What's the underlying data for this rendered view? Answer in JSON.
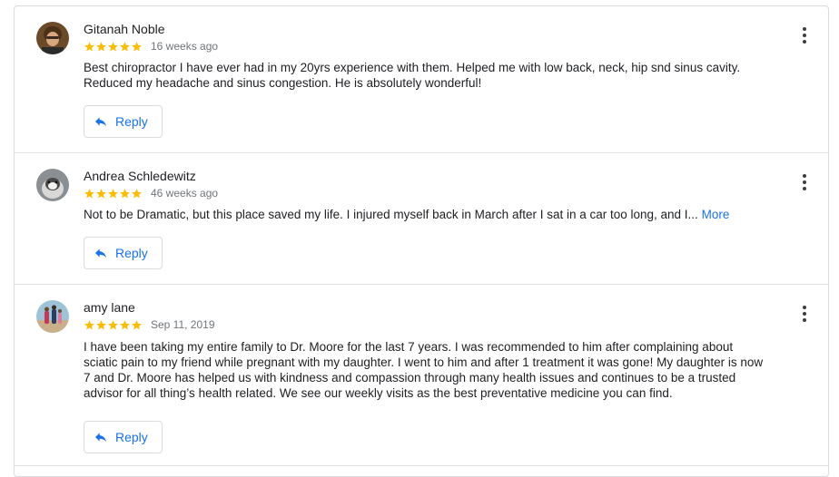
{
  "colors": {
    "star": "#fbbc04",
    "link": "#1a73e8",
    "meta": "#70757a",
    "border": "#dadce0"
  },
  "reviews": [
    {
      "name": "Gitanah Noble",
      "rating": 5,
      "date": "16 weeks ago",
      "text": "Best chiropractor I have ever had in my 20yrs experience with them. Helped me with low back, neck, hip snd sinus cavity. Reduced my headache and sinus congestion. He is absolutely wonderful!",
      "reply_label": "Reply"
    },
    {
      "name": "Andrea Schledewitz",
      "rating": 5,
      "date": "46 weeks ago",
      "text": "Not to be Dramatic, but this place saved my life. I injured myself back in March after I sat in a car too long, and I...",
      "more_label": "More",
      "reply_label": "Reply"
    },
    {
      "name": "amy lane",
      "rating": 5,
      "date": "Sep 11, 2019",
      "text": "I have been taking my entire family to Dr. Moore for the last 7 years. I was recommended to him after complaining about sciatic pain to my friend while pregnant with my daughter. I went to him and after 1 treatment it was gone! My daughter is now 7 and Dr. Moore has helped us with kindness and compassion through many health issues and continues to be a trusted advisor for all thing’s health related. We see our weekly visits as the best preventative medicine you can find.",
      "reply_label": "Reply"
    }
  ]
}
